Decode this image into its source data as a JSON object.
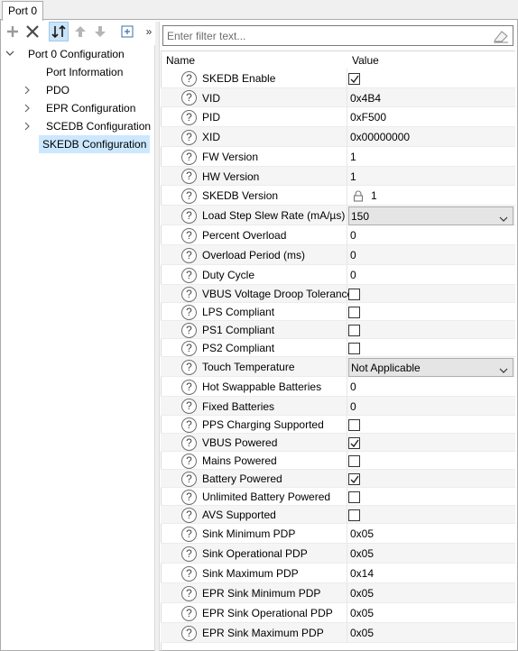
{
  "window": {
    "tab_label": "Port 0"
  },
  "toolbar": {
    "buttons": [
      {
        "icon": "plus-icon"
      },
      {
        "icon": "delete-x-icon"
      },
      {
        "icon": "sort-icon"
      },
      {
        "icon": "move-up-icon"
      },
      {
        "icon": "move-down-icon"
      },
      {
        "icon": "expand-collapse-icon"
      },
      {
        "icon": "overflow-chevron-icon",
        "label": "»"
      }
    ]
  },
  "tree": {
    "items": [
      {
        "label": "Port 0 Configuration",
        "expanded": true,
        "has_chevron": true
      },
      {
        "label": "Port Information",
        "has_chevron": false
      },
      {
        "label": "PDO",
        "has_chevron": true
      },
      {
        "label": "EPR Configuration",
        "has_chevron": true
      },
      {
        "label": "SCEDB Configuration",
        "has_chevron": true
      },
      {
        "label": "SKEDB Configuration",
        "has_chevron": false,
        "selected": true
      }
    ]
  },
  "filter": {
    "placeholder": "Enter filter text...",
    "value": ""
  },
  "grid": {
    "col_name": "Name",
    "col_value": "Value",
    "help_glyph": "?",
    "rows": [
      {
        "name": "SKEDB Enable",
        "type": "checkbox",
        "checked": true
      },
      {
        "name": "VID",
        "type": "text",
        "value": "0x4B4"
      },
      {
        "name": "PID",
        "type": "text",
        "value": "0xF500"
      },
      {
        "name": "XID",
        "type": "text",
        "value": "0x00000000"
      },
      {
        "name": "FW Version",
        "type": "text",
        "value": "1"
      },
      {
        "name": "HW Version",
        "type": "text",
        "value": "1"
      },
      {
        "name": "SKEDB Version",
        "type": "locked",
        "value": "1"
      },
      {
        "name": "Load Step Slew Rate (mA/µs)",
        "type": "dropdown",
        "value": "150"
      },
      {
        "name": "Percent Overload",
        "type": "text",
        "value": "0"
      },
      {
        "name": "Overload Period (ms)",
        "type": "text",
        "value": "0"
      },
      {
        "name": "Duty Cycle",
        "type": "text",
        "value": "0"
      },
      {
        "name": "VBUS Voltage Droop Tolerance",
        "type": "checkbox",
        "checked": false
      },
      {
        "name": "LPS Compliant",
        "type": "checkbox",
        "checked": false
      },
      {
        "name": "PS1 Compliant",
        "type": "checkbox",
        "checked": false
      },
      {
        "name": "PS2 Compliant",
        "type": "checkbox",
        "checked": false
      },
      {
        "name": "Touch Temperature",
        "type": "dropdown",
        "value": "Not Applicable"
      },
      {
        "name": "Hot Swappable Batteries",
        "type": "text",
        "value": "0"
      },
      {
        "name": "Fixed Batteries",
        "type": "text",
        "value": "0"
      },
      {
        "name": "PPS Charging Supported",
        "type": "checkbox",
        "checked": false
      },
      {
        "name": "VBUS Powered",
        "type": "checkbox",
        "checked": true
      },
      {
        "name": "Mains Powered",
        "type": "checkbox",
        "checked": false
      },
      {
        "name": "Battery Powered",
        "type": "checkbox",
        "checked": true
      },
      {
        "name": "Unlimited Battery Powered",
        "type": "checkbox",
        "checked": false
      },
      {
        "name": "AVS Supported",
        "type": "checkbox",
        "checked": false
      },
      {
        "name": "Sink Minimum PDP",
        "type": "text",
        "value": "0x05"
      },
      {
        "name": "Sink Operational PDP",
        "type": "text",
        "value": "0x05"
      },
      {
        "name": "Sink Maximum PDP",
        "type": "text",
        "value": "0x14"
      },
      {
        "name": "EPR Sink Minimum PDP",
        "type": "text",
        "value": "0x05"
      },
      {
        "name": "EPR Sink Operational PDP",
        "type": "text",
        "value": "0x05"
      },
      {
        "name": "EPR Sink Maximum PDP",
        "type": "text",
        "value": "0x05"
      }
    ]
  }
}
